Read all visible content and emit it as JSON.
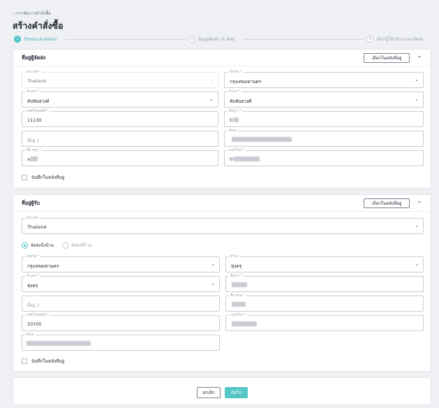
{
  "header": {
    "breadcrumb": "‹ การจัดการคำสั่งซื้อ",
    "title": "สร้างคำสั่งซื้อ"
  },
  "stepper": [
    {
      "num": "1",
      "label": "รับของและส่งของ"
    },
    {
      "num": "2",
      "label": "ข้อมูลสินค้า & พัสดุ"
    },
    {
      "num": "3",
      "label": "เลือกผู้ให้บริการและจัดส่ง"
    }
  ],
  "sender": {
    "title": "ที่อยู่ผู้จัดส่ง",
    "select_button": "เลือกในคลังที่อยู่",
    "country": {
      "label": "ประเทศ *",
      "value": "Thailand"
    },
    "province": {
      "label": "จังหวัด *",
      "value": "กรุงเทพมหานคร"
    },
    "district": {
      "label": "อำเภอ *",
      "value": "สัมพันธวงศ์"
    },
    "subdistrict": {
      "label": "ตำบล *",
      "value": "สัมพันธวงศ์"
    },
    "postcode": {
      "label": "รหัสไปรษณีย์ *",
      "value": "11130"
    },
    "address1": {
      "label": "ที่อยู่ 1 *",
      "value": "ti"
    },
    "address2": {
      "placeholder": "ที่อยู่ 2"
    },
    "email": {
      "label": "อีเมล"
    },
    "name": {
      "label": "ชื่อ สกุล *",
      "value": "x"
    },
    "phone": {
      "label": "เบอร์โทร *",
      "value": "0"
    },
    "save_label": "บันทึกในคลังที่อยู่"
  },
  "receiver": {
    "title": "ที่อยู่ผู้รับ",
    "select_button": "เลือกในคลังที่อยู่",
    "country": {
      "label": "ประเทศ",
      "value": "Thailand"
    },
    "delivery_home": "จัดส่งถึงบ้าน",
    "delivery_store": "จัดส่งที่ร้าน",
    "province": {
      "label": "จังหวัด *",
      "value": "กรุงเทพมหานคร"
    },
    "district": {
      "label": "อำเภอ *",
      "value": "ทุ่งครุ"
    },
    "subdistrict": {
      "label": "ตำบล",
      "value": "ทุ่งครุ"
    },
    "address1": {
      "label": "ที่อยู่ 1 *"
    },
    "address2": {
      "placeholder": "ที่อยู่ 2"
    },
    "name": {
      "label": "ชื่อ สกุล *"
    },
    "postcode": {
      "label": "รหัสไปรษณีย์ *",
      "value": "10700"
    },
    "phone": {
      "label": "เบอร์โทร *"
    },
    "email": {
      "label": "อีเมล"
    },
    "save_label": "บันทึกในคลังที่อยู่"
  },
  "footer": {
    "cancel": "ยกเลิก",
    "next": "ถัดไป"
  },
  "colors": {
    "accent": "#4cc2c4",
    "background": "#eef0f4"
  }
}
